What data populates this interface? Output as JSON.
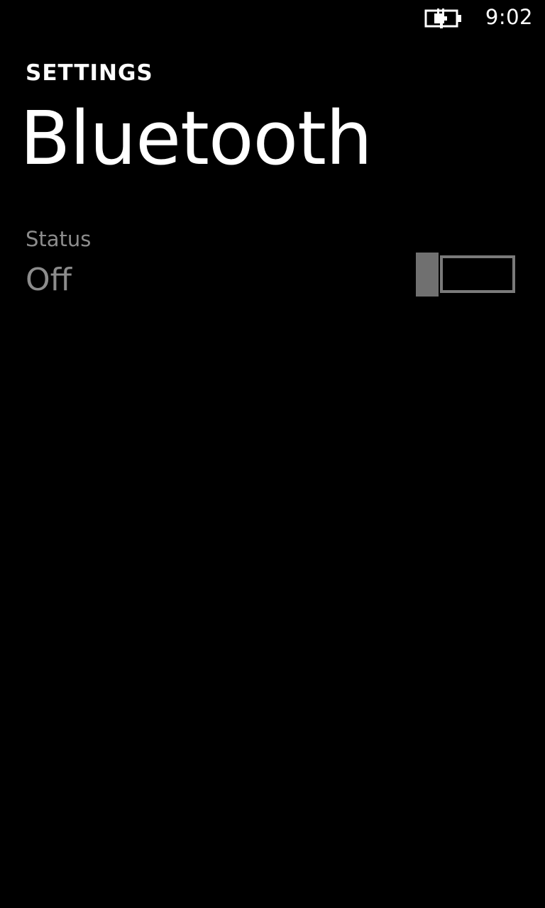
{
  "status_bar": {
    "battery_icon": "battery-charging-icon",
    "time": "9:02"
  },
  "header": {
    "section": "SETTINGS",
    "title": "Bluetooth"
  },
  "bluetooth": {
    "status_label": "Status",
    "status_value": "Off",
    "toggle_on": false
  },
  "colors": {
    "background": "#000000",
    "text": "#ffffff",
    "secondary_text": "#8c8c8c",
    "toggle": "#707070"
  }
}
